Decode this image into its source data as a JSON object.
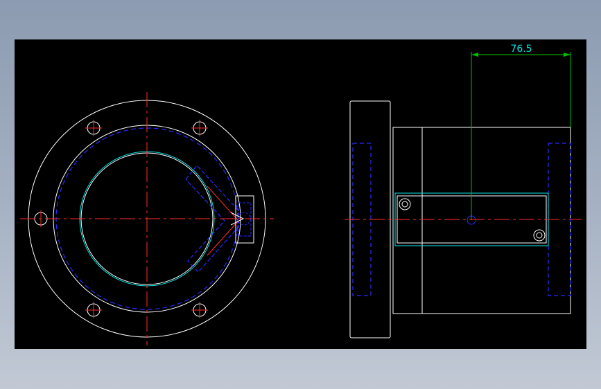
{
  "drawing": {
    "dimension_label": "76.5",
    "colors": {
      "background": "#000000",
      "outline": "#ffffff",
      "centerline": "#ff2a2a",
      "hidden": "#2a2aff",
      "highlight": "#00e5e5",
      "dimension": "#00c000",
      "dimension_text": "#00e5e5"
    }
  }
}
